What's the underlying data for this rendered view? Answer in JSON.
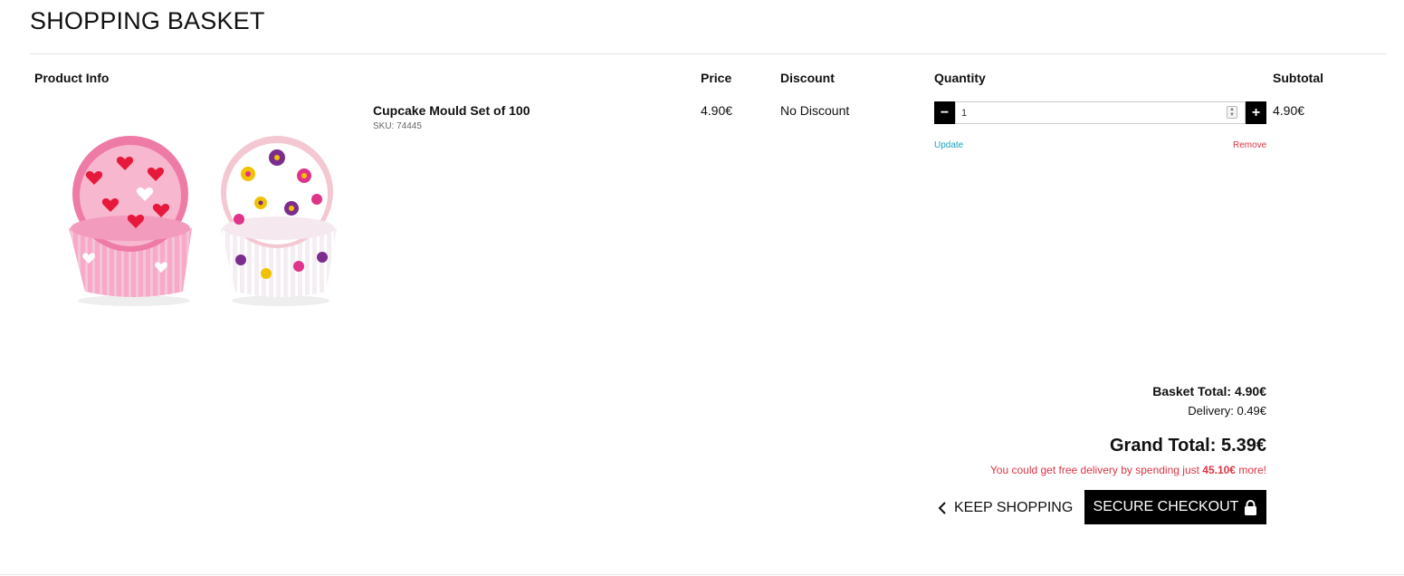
{
  "page": {
    "title": "SHOPPING BASKET"
  },
  "table": {
    "headers": {
      "product": "Product Info",
      "price": "Price",
      "discount": "Discount",
      "quantity": "Quantity",
      "subtotal": "Subtotal"
    },
    "items": [
      {
        "name": "Cupcake Mould Set of 100",
        "sku": "SKU: 74445",
        "price": "4.90€",
        "discount": "No Discount",
        "quantity": "1",
        "subtotal": "4.90€",
        "update_label": "Update",
        "remove_label": "Remove",
        "minus_label": "−",
        "plus_label": "+"
      }
    ]
  },
  "summary": {
    "basket_total": "Basket Total: 4.90€",
    "delivery": "Delivery: 0.49€",
    "grand_total": "Grand Total: 5.39€",
    "free_delivery_prefix": "You could get free delivery by spending just ",
    "free_delivery_amount": "45.10€",
    "free_delivery_suffix": " more!"
  },
  "actions": {
    "keep_shopping_label": "KEEP SHOPPING",
    "secure_checkout_label": "SECURE CHECKOUT"
  },
  "icons": {
    "keep_shopping": "chevron-left-icon",
    "checkout": "lock-icon",
    "quantity_spinner": "spinner-icon"
  },
  "colors": {
    "link_update": "#17a2b8",
    "link_remove": "#dc3545",
    "free_delivery_text": "#dc3545",
    "button_bg": "#000000"
  }
}
